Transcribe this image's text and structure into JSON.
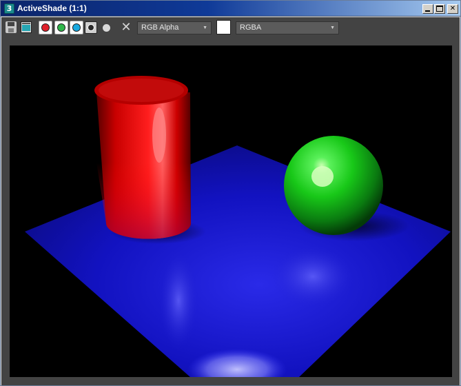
{
  "window": {
    "title": "ActiveShade (1:1)",
    "icon_glyph": "3",
    "minimize_label": "minimize",
    "maximize_label": "maximize",
    "close_glyph": "✕"
  },
  "toolbar": {
    "icons": {
      "save": "save-icon",
      "clone": "clone-rendered-frame-icon",
      "clear": "clear-icon"
    },
    "channels": [
      {
        "name": "red-channel",
        "color": "#e0202a"
      },
      {
        "name": "green-channel",
        "color": "#2fb64a"
      },
      {
        "name": "blue-channel",
        "color": "#18a9e0"
      },
      {
        "name": "alpha-channel",
        "color": "#2a2a2a"
      }
    ],
    "clear_glyph": "✕",
    "channel_display": "RGB Alpha",
    "swatch_color": "#ffffff",
    "render_mode": "RGBA",
    "dropdown_arrow": "▼"
  },
  "scene": {
    "background": "#000000",
    "plane_color": "#1414c8",
    "cylinder_color": "#ff1a1a",
    "sphere_color": "#22dd22"
  }
}
